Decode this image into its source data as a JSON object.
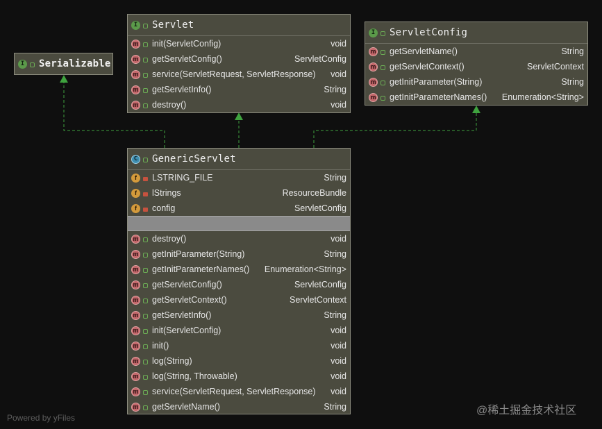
{
  "serializable": {
    "title": "Serializable",
    "icon": "interface-icon"
  },
  "servlet": {
    "title": "Servlet",
    "icon": "interface-icon",
    "methods": [
      {
        "name": "init(ServletConfig)",
        "type": "void"
      },
      {
        "name": "getServletConfig()",
        "type": "ServletConfig"
      },
      {
        "name": "service(ServletRequest, ServletResponse)",
        "type": "void"
      },
      {
        "name": "getServletInfo()",
        "type": "String"
      },
      {
        "name": "destroy()",
        "type": "void"
      }
    ]
  },
  "servlet_config": {
    "title": "ServletConfig",
    "icon": "interface-icon",
    "methods": [
      {
        "name": "getServletName()",
        "type": "String"
      },
      {
        "name": "getServletContext()",
        "type": "ServletContext"
      },
      {
        "name": "getInitParameter(String)",
        "type": "String"
      },
      {
        "name": "getInitParameterNames()",
        "type": "Enumeration<String>"
      }
    ]
  },
  "generic_servlet": {
    "title": "GenericServlet",
    "icon": "abstract-class-icon",
    "fields": [
      {
        "name": "LSTRING_FILE",
        "type": "String"
      },
      {
        "name": "lStrings",
        "type": "ResourceBundle"
      },
      {
        "name": "config",
        "type": "ServletConfig"
      }
    ],
    "methods": [
      {
        "name": "destroy()",
        "type": "void"
      },
      {
        "name": "getInitParameter(String)",
        "type": "String"
      },
      {
        "name": "getInitParameterNames()",
        "type": "Enumeration<String>"
      },
      {
        "name": "getServletConfig()",
        "type": "ServletConfig"
      },
      {
        "name": "getServletContext()",
        "type": "ServletContext"
      },
      {
        "name": "getServletInfo()",
        "type": "String"
      },
      {
        "name": "init(ServletConfig)",
        "type": "void"
      },
      {
        "name": "init()",
        "type": "void"
      },
      {
        "name": "log(String)",
        "type": "void"
      },
      {
        "name": "log(String, Throwable)",
        "type": "void"
      },
      {
        "name": "service(ServletRequest, ServletResponse)",
        "type": "void"
      },
      {
        "name": "getServletName()",
        "type": "String"
      }
    ]
  },
  "colors": {
    "edge": "#3fa33f",
    "box": "#4b4b3f",
    "background": "#0f0f0f"
  },
  "watermark_left": "Powered by yFiles",
  "watermark_right": "@稀土掘金技术社区"
}
